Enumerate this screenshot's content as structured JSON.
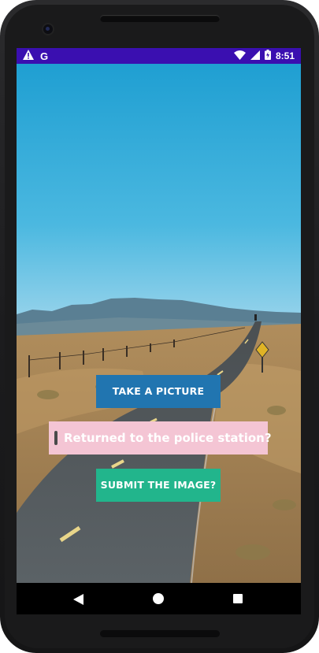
{
  "status_bar": {
    "time": "8:51",
    "left_icons": [
      "warning-icon",
      "google-g-icon"
    ],
    "g_letter": "G",
    "right_icons": [
      "wifi-icon",
      "signal-icon",
      "battery-icon"
    ],
    "bar_color": "#3a0fb0"
  },
  "main": {
    "take_picture_label": "TAKE A PICTURE",
    "returned_checkbox_label": "Returned to the police station?",
    "returned_checked": false,
    "submit_label": "SUBMIT THE IMAGE?"
  },
  "colors": {
    "take_button": "#2175b0",
    "submit_button": "#22b58c",
    "checkbox_row": "#f4c5d4"
  },
  "nav_bar": {
    "icons": [
      "back-icon",
      "home-icon",
      "recents-icon"
    ]
  }
}
